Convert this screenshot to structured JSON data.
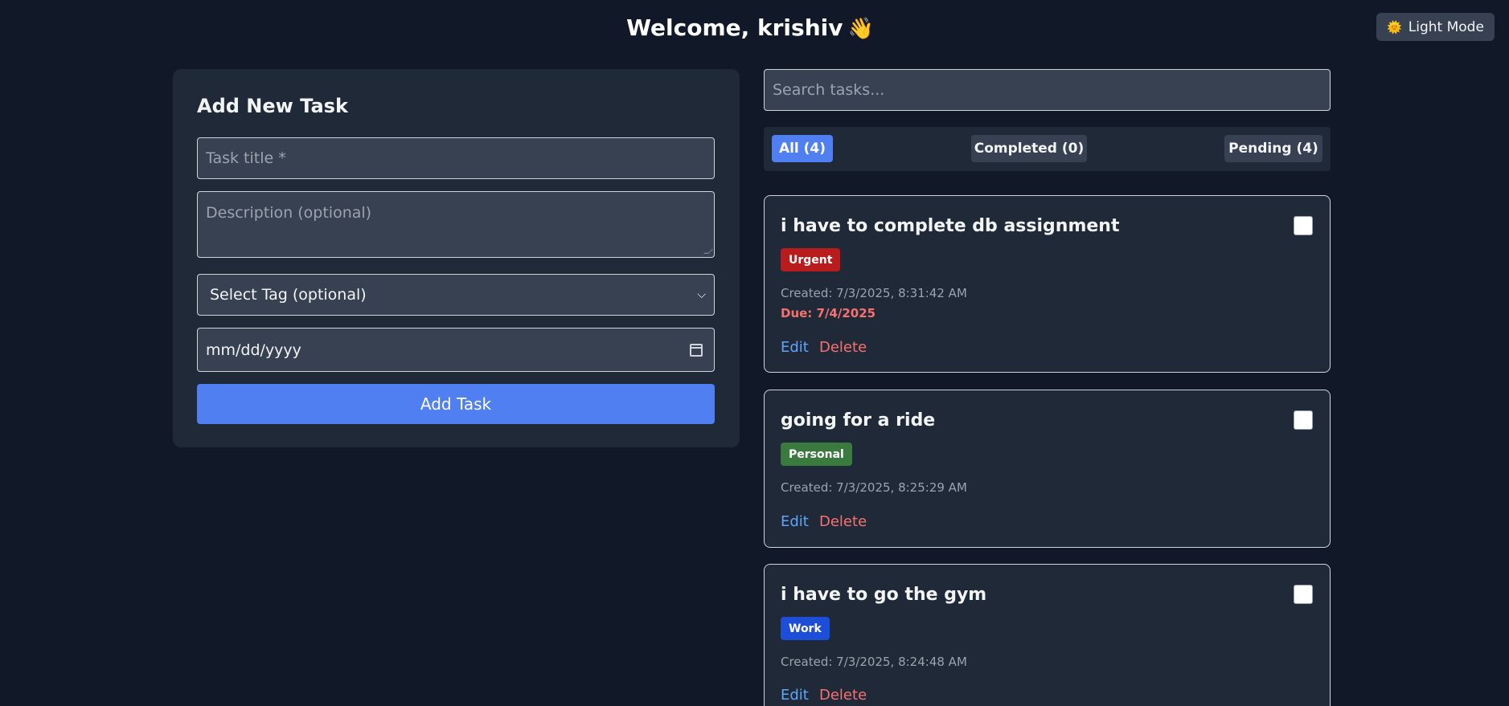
{
  "header": {
    "welcome": "Welcome, krishiv",
    "wave_icon": "waving-hand-icon",
    "theme_toggle_label": "Light Mode",
    "theme_toggle_icon": "sun-icon"
  },
  "add_form": {
    "heading": "Add New Task",
    "title_placeholder": "Task title *",
    "description_placeholder": "Description (optional)",
    "tag_select_value": "Select Tag (optional)",
    "date_placeholder": "mm/dd/yyyy",
    "submit_label": "Add Task"
  },
  "search": {
    "placeholder": "Search tasks..."
  },
  "filters": {
    "all": "All (4)",
    "completed": "Completed (0)",
    "pending": "Pending (4)",
    "active": "all"
  },
  "tasks": [
    {
      "title": "i have to complete db assignment",
      "tag": "Urgent",
      "tag_color": "#b91c1c",
      "created": "Created: 7/3/2025, 8:31:42 AM",
      "due": "Due: 7/4/2025",
      "edit": "Edit",
      "delete": "Delete"
    },
    {
      "title": "going for a ride",
      "tag": "Personal",
      "tag_color": "#3b7a3f",
      "created": "Created: 7/3/2025, 8:25:29 AM",
      "edit": "Edit",
      "delete": "Delete"
    },
    {
      "title": "i have to go the gym",
      "tag": "Work",
      "tag_color": "#1d4ed8",
      "created": "Created: 7/3/2025, 8:24:48 AM",
      "edit": "Edit",
      "delete": "Delete"
    }
  ]
}
